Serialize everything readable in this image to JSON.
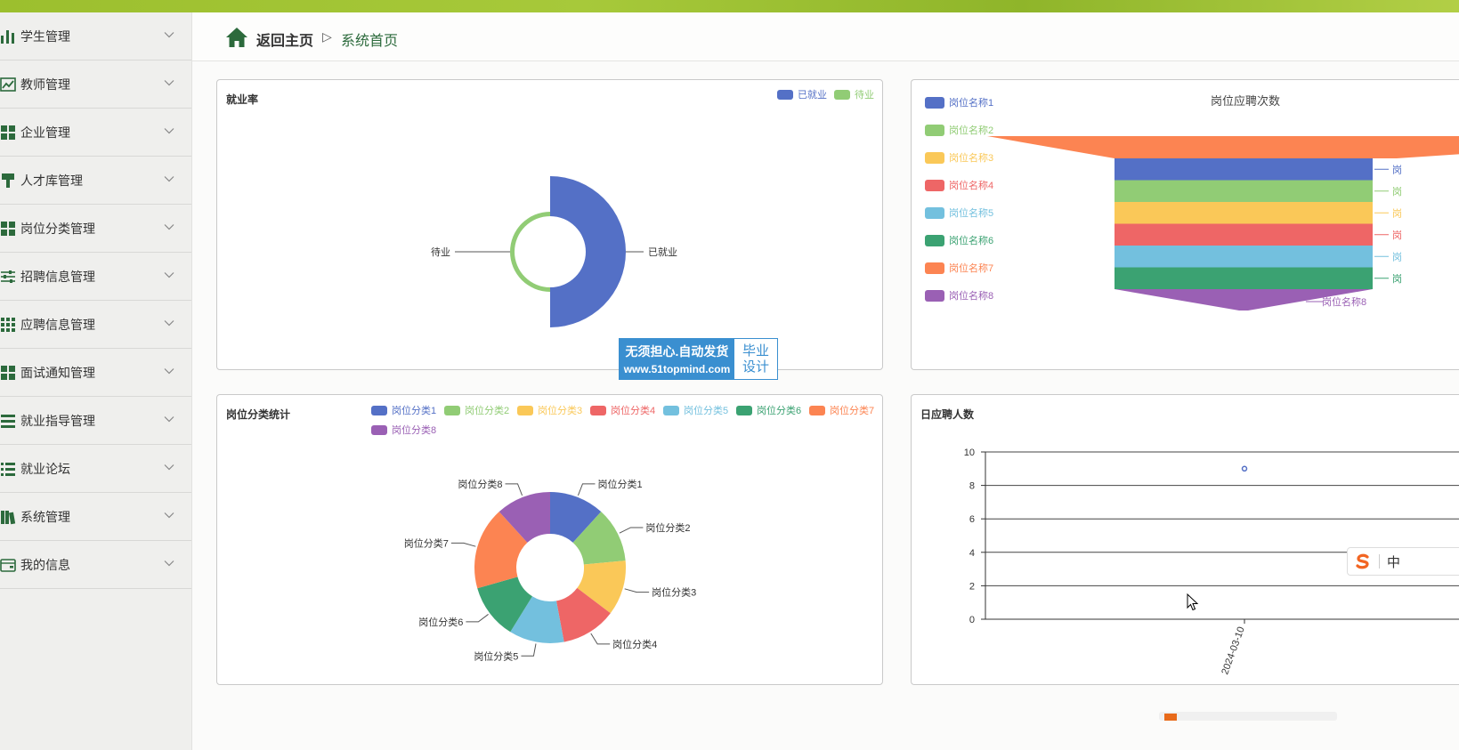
{
  "breadcrumb": {
    "home_label": "返回主页",
    "separator": "▷",
    "current": "系统首页"
  },
  "sidebar": {
    "items": [
      {
        "label": "学生管理",
        "icon": "bar-chart-icon"
      },
      {
        "label": "教师管理",
        "icon": "line-chart-icon"
      },
      {
        "label": "企业管理",
        "icon": "grid-icon"
      },
      {
        "label": "人才库管理",
        "icon": "brush-icon"
      },
      {
        "label": "岗位分类管理",
        "icon": "grid-icon"
      },
      {
        "label": "招聘信息管理",
        "icon": "sliders-icon"
      },
      {
        "label": "应聘信息管理",
        "icon": "apps-icon"
      },
      {
        "label": "面试通知管理",
        "icon": "grid-icon"
      },
      {
        "label": "就业指导管理",
        "icon": "list-icon"
      },
      {
        "label": "就业论坛",
        "icon": "list-indent-icon"
      },
      {
        "label": "系统管理",
        "icon": "books-icon"
      },
      {
        "label": "我的信息",
        "icon": "wallet-icon"
      }
    ]
  },
  "colors": {
    "palette": [
      "#5470c6",
      "#91cc75",
      "#fac858",
      "#ee6666",
      "#73c0de",
      "#3ba272",
      "#fc8452",
      "#9a60b4"
    ],
    "brand_green": "#2c6a3c",
    "topbar": "#9cbf2e"
  },
  "panels": {
    "employment": {
      "title": "就业率",
      "chart_data": {
        "type": "pie",
        "variant": "nightingale-rose",
        "categories": [
          "已就业",
          "待业"
        ],
        "values": [
          90,
          10
        ],
        "legend": [
          "已就业",
          "待业"
        ],
        "legend_position": "top-right"
      }
    },
    "funnel": {
      "title": "岗位应聘次数",
      "chart_data": {
        "type": "funnel",
        "categories": [
          "岗位名称1",
          "岗位名称2",
          "岗位名称3",
          "岗位名称4",
          "岗位名称5",
          "岗位名称6",
          "岗位名称7",
          "岗位名称8"
        ],
        "visible_labels": [
          "岗",
          "岗",
          "岗",
          "岗",
          "岗",
          "岗",
          "",
          "岗位名称8"
        ],
        "legend_position": "left"
      }
    },
    "category": {
      "title": "岗位分类统计",
      "chart_data": {
        "type": "pie",
        "variant": "donut",
        "categories": [
          "岗位分类1",
          "岗位分类2",
          "岗位分类3",
          "岗位分类4",
          "岗位分类5",
          "岗位分类6",
          "岗位分类7",
          "岗位分类8"
        ],
        "values": [
          1,
          1,
          1,
          1,
          1,
          1,
          1.5,
          1
        ],
        "legend_position": "top"
      }
    },
    "daily": {
      "title": "日应聘人数",
      "chart_data": {
        "type": "scatter",
        "x": [
          "2024-03-10"
        ],
        "y": [
          9
        ],
        "yticks": [
          "0",
          "2",
          "4",
          "6",
          "8",
          "10"
        ],
        "xtick_label": "2024-03-10",
        "ylim": [
          0,
          10
        ],
        "grid": true
      }
    }
  },
  "watermark": {
    "line1": "无须担心.自动发货",
    "line2": "www.51topmind.com",
    "right_line1": "毕业",
    "right_line2": "设计"
  },
  "ime": {
    "label": "中"
  }
}
